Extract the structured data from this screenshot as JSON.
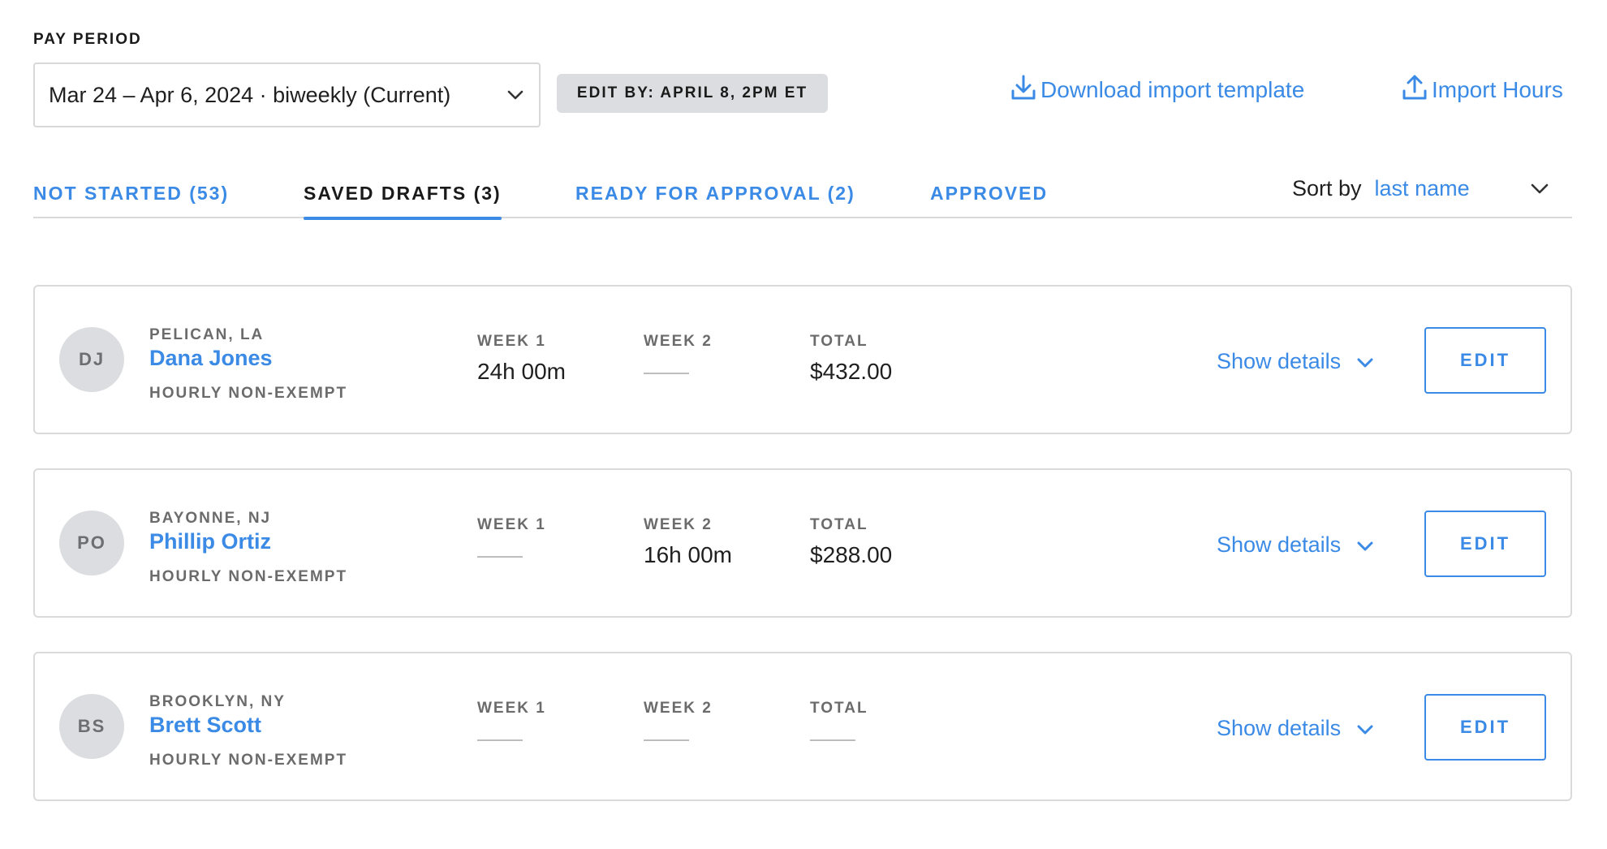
{
  "pay_period": {
    "label": "PAY PERIOD",
    "selected": "Mar 24 – Apr 6, 2024 · biweekly (Current)",
    "edit_by": "EDIT BY: APRIL 8, 2PM ET"
  },
  "actions": {
    "download_template": "Download import template",
    "import_hours": "Import Hours"
  },
  "tabs": [
    {
      "label": "NOT STARTED (53)",
      "active": false
    },
    {
      "label": "SAVED DRAFTS (3)",
      "active": true
    },
    {
      "label": "READY FOR APPROVAL (2)",
      "active": false
    },
    {
      "label": "APPROVED",
      "active": false
    }
  ],
  "sort": {
    "label": "Sort by",
    "value": "last name"
  },
  "columns": {
    "week1": "WEEK 1",
    "week2": "WEEK 2",
    "total": "TOTAL"
  },
  "employees": [
    {
      "initials": "DJ",
      "location": "PELICAN, LA",
      "name": "Dana Jones",
      "pay_type": "HOURLY NON-EXEMPT",
      "week1": "24h 00m",
      "week2": "——",
      "total": "$432.00",
      "show_details": "Show details",
      "edit": "EDIT"
    },
    {
      "initials": "PO",
      "location": "BAYONNE, NJ",
      "name": "Phillip Ortiz",
      "pay_type": "HOURLY NON-EXEMPT",
      "week1": "——",
      "week2": "16h 00m",
      "total": "$288.00",
      "show_details": "Show details",
      "edit": "EDIT"
    },
    {
      "initials": "BS",
      "location": "BROOKLYN, NY",
      "name": "Brett Scott",
      "pay_type": "HOURLY NON-EXEMPT",
      "week1": "——",
      "week2": "——",
      "total": "——",
      "show_details": "Show details",
      "edit": "EDIT"
    }
  ],
  "colors": {
    "accent": "#3a8ae6",
    "muted_text": "#6b6b6b",
    "chip_bg": "#dcdde0"
  }
}
